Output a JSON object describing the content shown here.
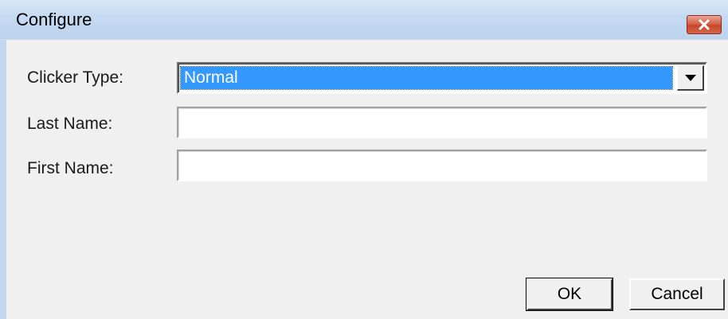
{
  "window": {
    "title": "Configure",
    "close_icon": "close-icon"
  },
  "form": {
    "clicker_type": {
      "label": "Clicker Type:",
      "selected_value": "Normal",
      "dropdown_icon": "chevron-down-icon"
    },
    "last_name": {
      "label": "Last Name:",
      "value": ""
    },
    "first_name": {
      "label": "First Name:",
      "value": ""
    }
  },
  "buttons": {
    "ok_label": "OK",
    "cancel_label": "Cancel"
  },
  "colors": {
    "selection_highlight": "#3399ff",
    "titlebar": "#c6dbf2",
    "close_button": "#c8462c",
    "dialog_background": "#f0f0f0"
  }
}
